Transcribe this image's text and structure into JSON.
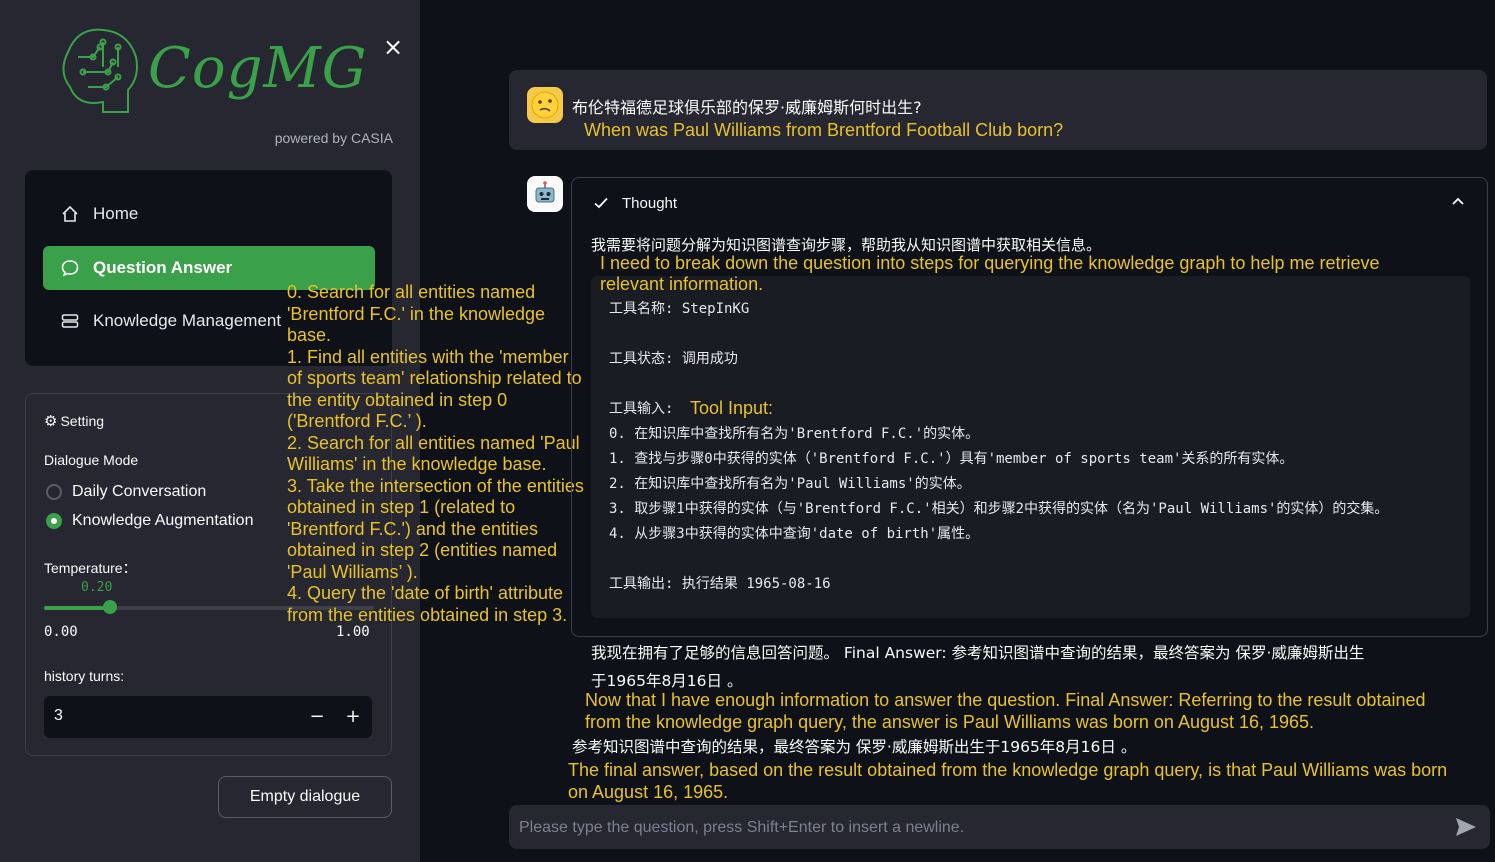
{
  "sidebar": {
    "logo_text": "CogMG",
    "powered_by": "powered by CASIA",
    "close_icon": "×",
    "nav": [
      {
        "label": "Home",
        "icon": "home-icon"
      },
      {
        "label": "Question Answer",
        "icon": "chat-bubble-icon",
        "active": true
      },
      {
        "label": "Knowledge Management",
        "icon": "database-icon"
      }
    ],
    "settings": {
      "title": "Setting",
      "dialogue_mode_label": "Dialogue Mode",
      "options": [
        "Daily Conversation",
        "Knowledge Augmentation"
      ],
      "selected_option": "Knowledge Augmentation",
      "temperature_label": "Temperature：",
      "temperature_value": "0.20",
      "temperature_min": "0.00",
      "temperature_max": "1.00",
      "temperature_fraction": 0.2,
      "history_label": "history turns:",
      "history_value": "3",
      "minus": "−",
      "plus": "+"
    },
    "empty_button": "Empty dialogue"
  },
  "overlay_steps": [
    "0. Search for all entities named 'Brentford F.C.' in the knowledge base.",
    "1. Find all entities with the 'member of sports team' relationship related to the entity obtained in step 0 ('Brentford F.C.’ ).",
    "2. Search for all entities named 'Paul Williams' in the knowledge base.",
    "3. Take the intersection of the entities obtained in step 1 (related to 'Brentford F.C.') and the entities obtained in step 2 (entities named 'Paul Williams’ ).",
    "4. Query the 'date of birth' attribute from the entities obtained in step 3."
  ],
  "chat": {
    "user_question_zh": "布伦特福德足球俱乐部的保罗·威廉姆斯何时出生?",
    "user_question_en": "When was Paul Williams from Brentford Football Club born?",
    "thought_label": "Thought",
    "thought_zh": "我需要将问题分解为知识图谱查询步骤，帮助我从知识图谱中获取相关信息。",
    "thought_en": "I need to break down the question into steps for querying the knowledge graph to help me retrieve relevant information.",
    "tool_name": "工具名称: StepInKG",
    "tool_status": "工具状态: 调用成功",
    "tool_input_label": "工具输入:",
    "tool_input_en": "Tool Input:",
    "tool_steps": [
      "0. 在知识库中查找所有名为'Brentford F.C.'的实体。",
      "1. 查找与步骤0中获得的实体（'Brentford F.C.'）具有'member of sports team'关系的所有实体。",
      "2. 在知识库中查找所有名为'Paul Williams'的实体。",
      "3. 取步骤1中获得的实体（与'Brentford F.C.'相关）和步骤2中获得的实体（名为'Paul Williams'的实体）的交集。",
      "4. 从步骤3中获得的实体中查询'date of birth'属性。"
    ],
    "tool_output": "工具输出: 执行结果 1965-08-16",
    "final_zh_1": "我现在拥有了足够的信息回答问题。 Final Answer: 参考知识图谱中查询的结果，最终答案为 保罗·威廉姆斯出生",
    "final_zh_2": "于1965年8月16日 。",
    "final_en": "Now that I have enough information to answer the question. Final Answer: Referring to the result obtained from the knowledge graph query, the answer is Paul Williams was born on August 16, 1965.",
    "answer_zh": "参考知识图谱中查询的结果，最终答案为 保罗·威廉姆斯出生于1965年8月16日 。",
    "answer_en": "The final answer, based on the result obtained from the knowledge graph query, is that Paul Williams was born on August 16, 1965.",
    "input_placeholder": "Please type the question, press Shift+Enter to insert a newline."
  },
  "colors": {
    "accent": "#3aa04a",
    "annotation": "#e8c22a",
    "background": "#0e1117",
    "sidebar": "#262730"
  }
}
